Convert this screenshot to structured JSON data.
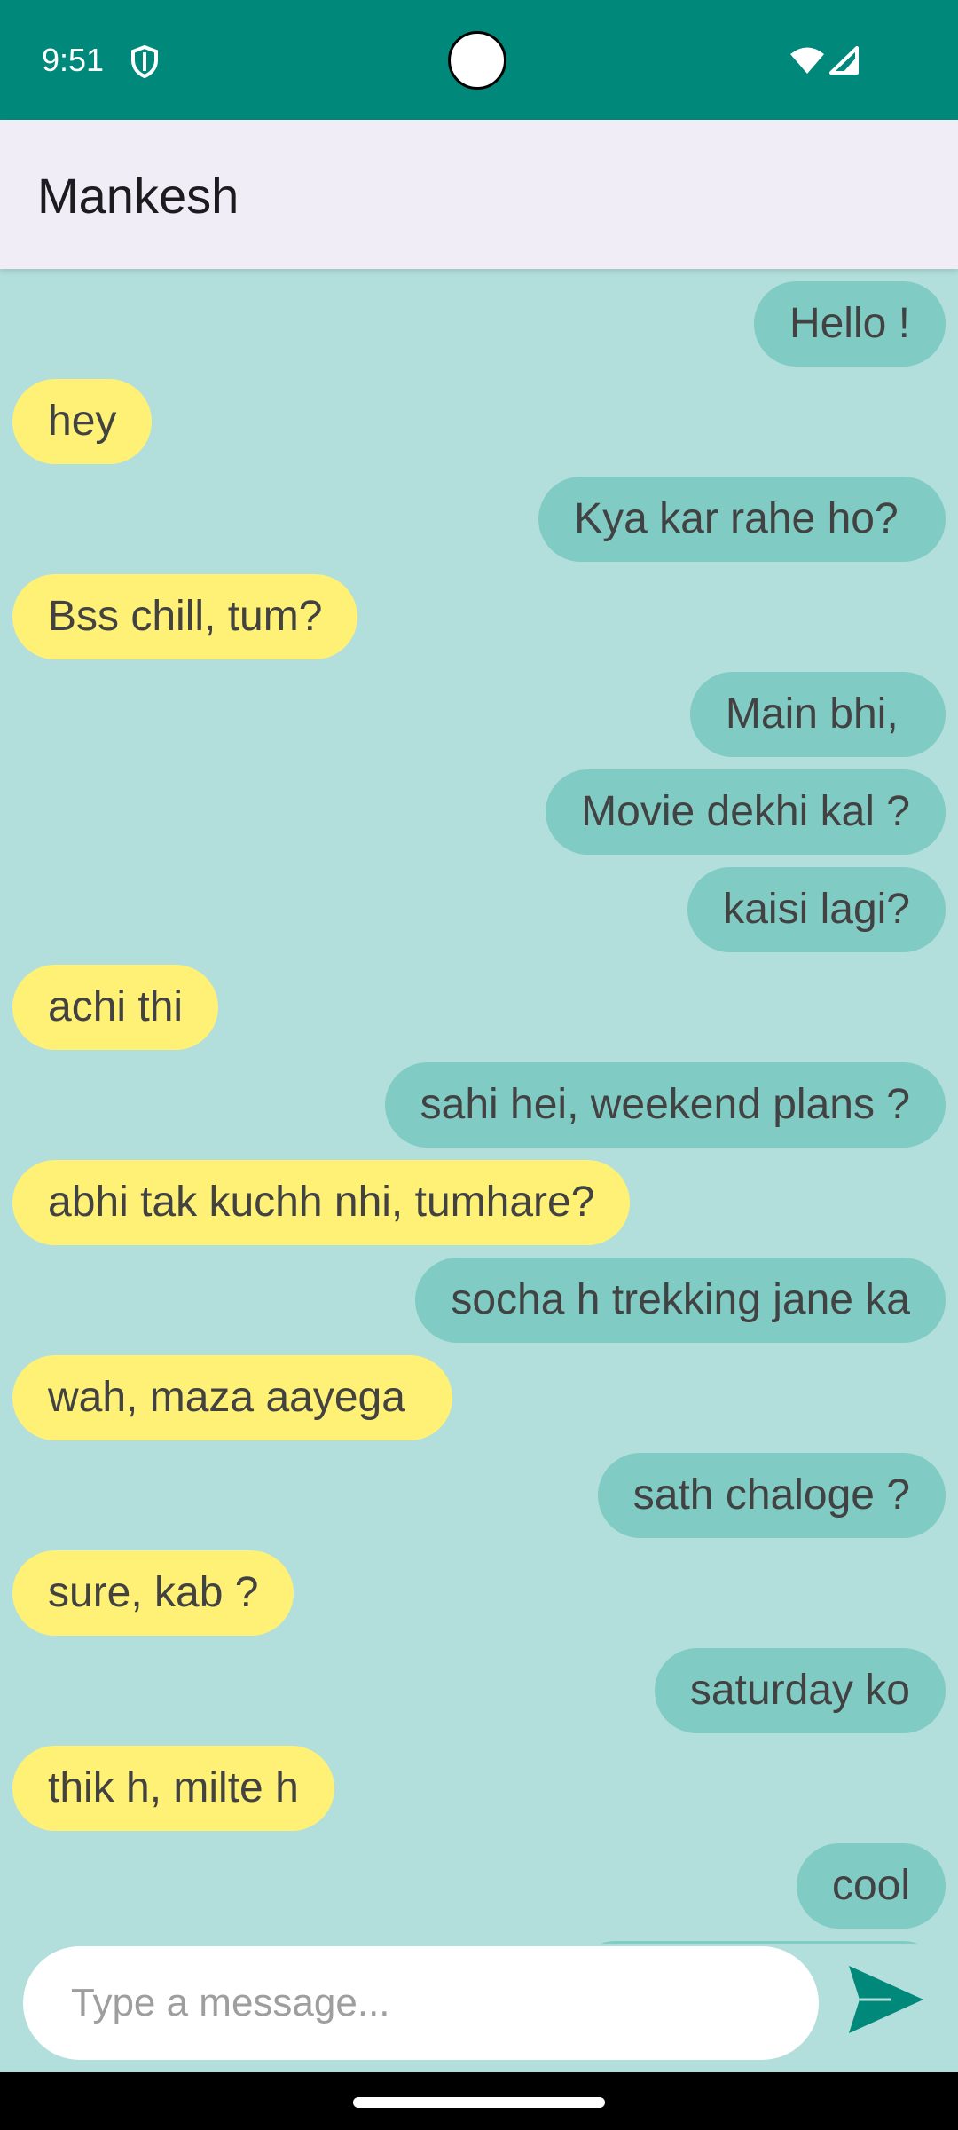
{
  "status_bar": {
    "time": "9:51",
    "icons": [
      "shield-icon",
      "wifi-icon",
      "signal-icon"
    ],
    "color": "#00897b"
  },
  "app_bar": {
    "title": "Mankesh",
    "background": "#f1edf6"
  },
  "chat": {
    "background": "#b2dfdb",
    "sent_color": "#80cbc4",
    "received_color": "#fff176",
    "messages": [
      {
        "side": "sent",
        "text": "Hello !"
      },
      {
        "side": "received",
        "text": "hey"
      },
      {
        "side": "sent",
        "text": "Kya kar rahe ho? "
      },
      {
        "side": "received",
        "text": "Bss chill, tum?"
      },
      {
        "side": "sent",
        "text": "Main bhi, "
      },
      {
        "side": "sent",
        "text": "Movie dekhi kal ?"
      },
      {
        "side": "sent",
        "text": "kaisi lagi?"
      },
      {
        "side": "received",
        "text": "achi thi"
      },
      {
        "side": "sent",
        "text": "sahi hei, weekend plans ?"
      },
      {
        "side": "received",
        "text": "abhi tak kuchh nhi, tumhare?"
      },
      {
        "side": "sent",
        "text": "socha h trekking jane ka"
      },
      {
        "side": "received",
        "text": "wah, maza aayega "
      },
      {
        "side": "sent",
        "text": "sath chaloge ?"
      },
      {
        "side": "received",
        "text": "sure, kab ?"
      },
      {
        "side": "sent",
        "text": "saturday ko"
      },
      {
        "side": "received",
        "text": "thik h, milte h"
      },
      {
        "side": "sent",
        "text": "cool"
      }
    ]
  },
  "composer": {
    "placeholder": "Type a message...",
    "value": "",
    "send_icon": "send-icon",
    "send_color": "#00897b"
  }
}
